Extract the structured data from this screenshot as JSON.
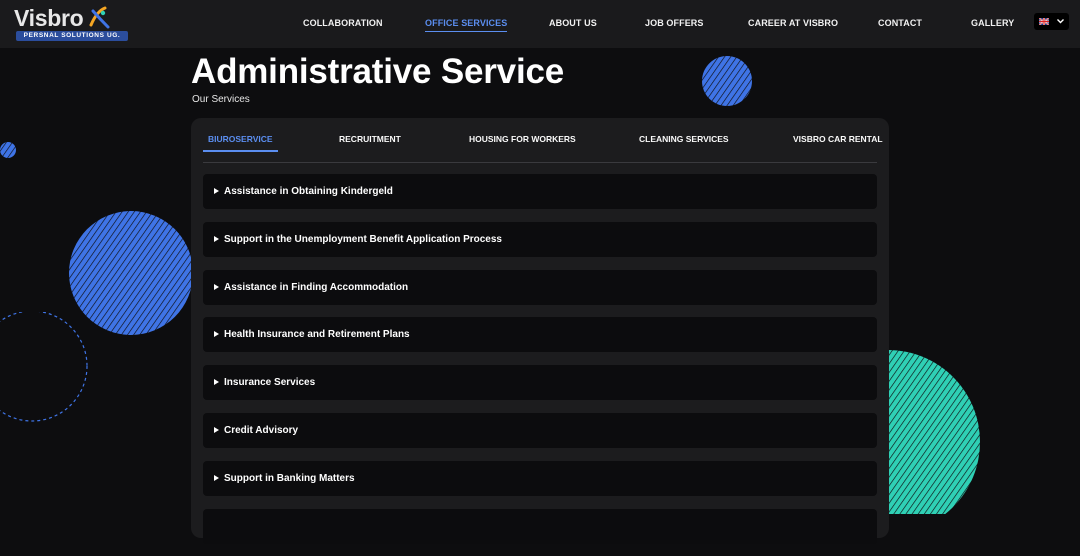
{
  "brand": {
    "name": "Visbro",
    "tagline": "PERSNAL SOLUTIONS UG.",
    "colors": {
      "primary": "#2b4d9c",
      "accent": "#5b8ef0",
      "teal": "#2fd0b5",
      "orange": "#f5a623"
    }
  },
  "nav": {
    "items": [
      {
        "label": "COLLABORATION",
        "active": false
      },
      {
        "label": "OFFICE SERVICES",
        "active": true
      },
      {
        "label": "ABOUT US",
        "active": false
      },
      {
        "label": "JOB OFFERS",
        "active": false
      },
      {
        "label": "CAREER AT VISBRO",
        "active": false
      },
      {
        "label": "CONTACT",
        "active": false
      },
      {
        "label": "GALLERY",
        "active": false
      }
    ],
    "language": {
      "flag_icon": "uk-flag-icon",
      "dropdown_icon": "chevron-down-icon"
    }
  },
  "page": {
    "title": "Administrative Service",
    "subtitle": "Our Services"
  },
  "tabs": [
    {
      "label": "BIUROSERVICE",
      "active": true
    },
    {
      "label": "RECRUITMENT",
      "active": false
    },
    {
      "label": "HOUSING FOR WORKERS",
      "active": false
    },
    {
      "label": "CLEANING SERVICES",
      "active": false
    },
    {
      "label": "VISBRO CAR RENTAL",
      "active": false
    }
  ],
  "accordion": {
    "expand_icon": "triangle-right-icon",
    "items": [
      {
        "label": "Assistance in Obtaining Kindergeld"
      },
      {
        "label": "Support in the Unemployment Benefit Application Process"
      },
      {
        "label": "Assistance in Finding Accommodation"
      },
      {
        "label": "Health Insurance and Retirement Plans"
      },
      {
        "label": "Insurance Services"
      },
      {
        "label": "Credit Advisory"
      },
      {
        "label": "Support in Banking Matters"
      },
      {
        "label": ""
      }
    ]
  }
}
